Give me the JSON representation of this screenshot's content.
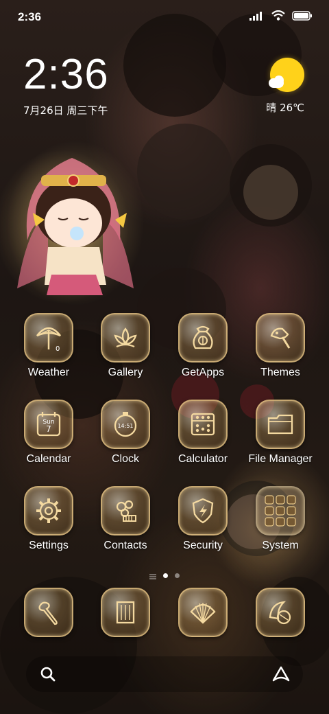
{
  "status_bar": {
    "time": "2:36"
  },
  "clock_widget": {
    "time": "2:36",
    "date": "7月26日 周三下午"
  },
  "weather_widget": {
    "condition": "晴",
    "temperature": "26℃"
  },
  "apps": [
    {
      "label": "Weather",
      "icon": "umbrella-icon",
      "sub": "0"
    },
    {
      "label": "Gallery",
      "icon": "lotus-icon"
    },
    {
      "label": "GetApps",
      "icon": "treasure-bag-icon"
    },
    {
      "label": "Themes",
      "icon": "brush-icon"
    },
    {
      "label": "Calendar",
      "icon": "calendar-icon",
      "day_name": "Sun",
      "day_num": "7"
    },
    {
      "label": "Clock",
      "icon": "clock-icon",
      "clock_text": "14:51"
    },
    {
      "label": "Calculator",
      "icon": "abacus-icon"
    },
    {
      "label": "File Manager",
      "icon": "folder-icon"
    },
    {
      "label": "Settings",
      "icon": "gear-icon"
    },
    {
      "label": "Contacts",
      "icon": "comb-flower-icon"
    },
    {
      "label": "Security",
      "icon": "shield-icon"
    },
    {
      "label": "System",
      "icon": "folder-grid-icon"
    }
  ],
  "dock": [
    {
      "icon": "ruyi-icon"
    },
    {
      "icon": "scroll-icon"
    },
    {
      "icon": "fan-icon"
    },
    {
      "icon": "fan-shell-icon"
    }
  ],
  "colors": {
    "icon_gold": "#f0cd8c",
    "sun": "#ffd21a"
  }
}
